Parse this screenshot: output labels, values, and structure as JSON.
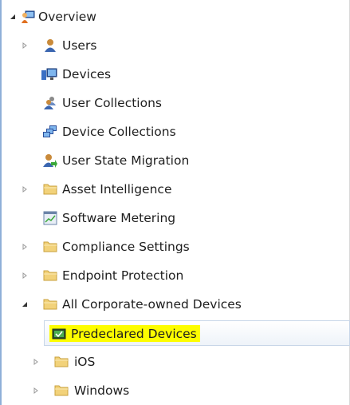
{
  "tree": {
    "items": [
      {
        "label": "Overview",
        "icon": "overview-icon",
        "expander": "expanded"
      },
      {
        "label": "Users",
        "icon": "user-icon",
        "expander": "collapsed"
      },
      {
        "label": "Devices",
        "icon": "devices-icon",
        "expander": "none"
      },
      {
        "label": "User Collections",
        "icon": "user-collections-icon",
        "expander": "none"
      },
      {
        "label": "Device Collections",
        "icon": "device-collections-icon",
        "expander": "none"
      },
      {
        "label": "User State Migration",
        "icon": "user-state-migration-icon",
        "expander": "none"
      },
      {
        "label": "Asset Intelligence",
        "icon": "folder-icon",
        "expander": "collapsed"
      },
      {
        "label": "Software Metering",
        "icon": "software-metering-icon",
        "expander": "none"
      },
      {
        "label": "Compliance Settings",
        "icon": "folder-icon",
        "expander": "collapsed"
      },
      {
        "label": "Endpoint Protection",
        "icon": "folder-icon",
        "expander": "collapsed"
      },
      {
        "label": "All Corporate-owned Devices",
        "icon": "folder-icon",
        "expander": "expanded"
      },
      {
        "label": "Predeclared Devices",
        "icon": "predeclared-devices-icon",
        "expander": "none",
        "selected": true
      },
      {
        "label": "iOS",
        "icon": "folder-icon",
        "expander": "collapsed"
      },
      {
        "label": "Windows",
        "icon": "folder-icon",
        "expander": "collapsed"
      }
    ]
  },
  "colors": {
    "highlight": "#fdfd00",
    "selection_border": "#c8d6e8",
    "left_border": "#8fb0d8",
    "folder": "#f2d27a"
  }
}
